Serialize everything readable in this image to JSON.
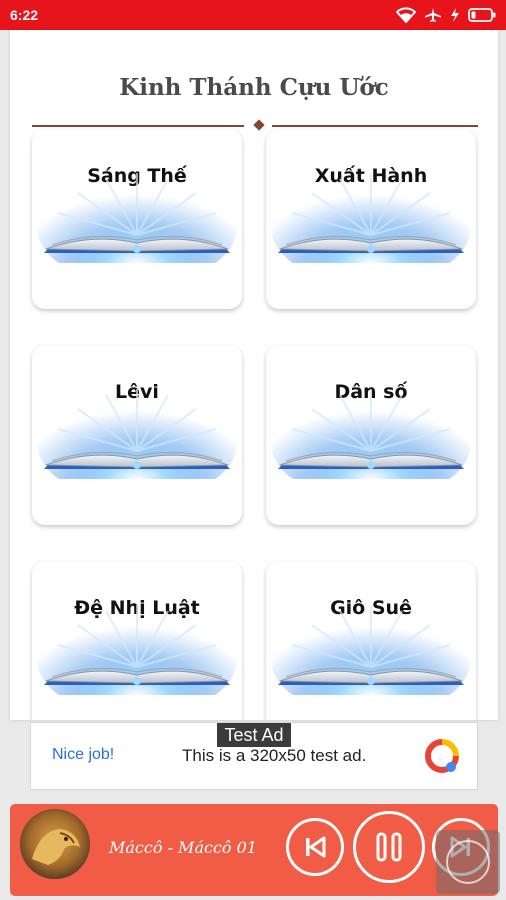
{
  "status_bar": {
    "time": "6:22",
    "icons": [
      "wifi-icon",
      "airplane-icon",
      "battery-charging-icon"
    ],
    "color": "#e8141b"
  },
  "page": {
    "title": "Kinh Thánh Cựu Ước"
  },
  "books": [
    {
      "name": "Sáng Thế"
    },
    {
      "name": "Xuất Hành"
    },
    {
      "name": "Lêvi"
    },
    {
      "name": "Dân số"
    },
    {
      "name": "Đệ Nhị Luật"
    },
    {
      "name": "Giô Suê"
    }
  ],
  "ad": {
    "tag": "Test Ad",
    "nice_label": "Nice job!",
    "text": "This is a 320x50 test ad."
  },
  "player": {
    "track_title": "Máccô - Máccô 01",
    "accent": "#f15c47",
    "controls": [
      "previous-icon",
      "pause-icon",
      "next-icon"
    ]
  }
}
